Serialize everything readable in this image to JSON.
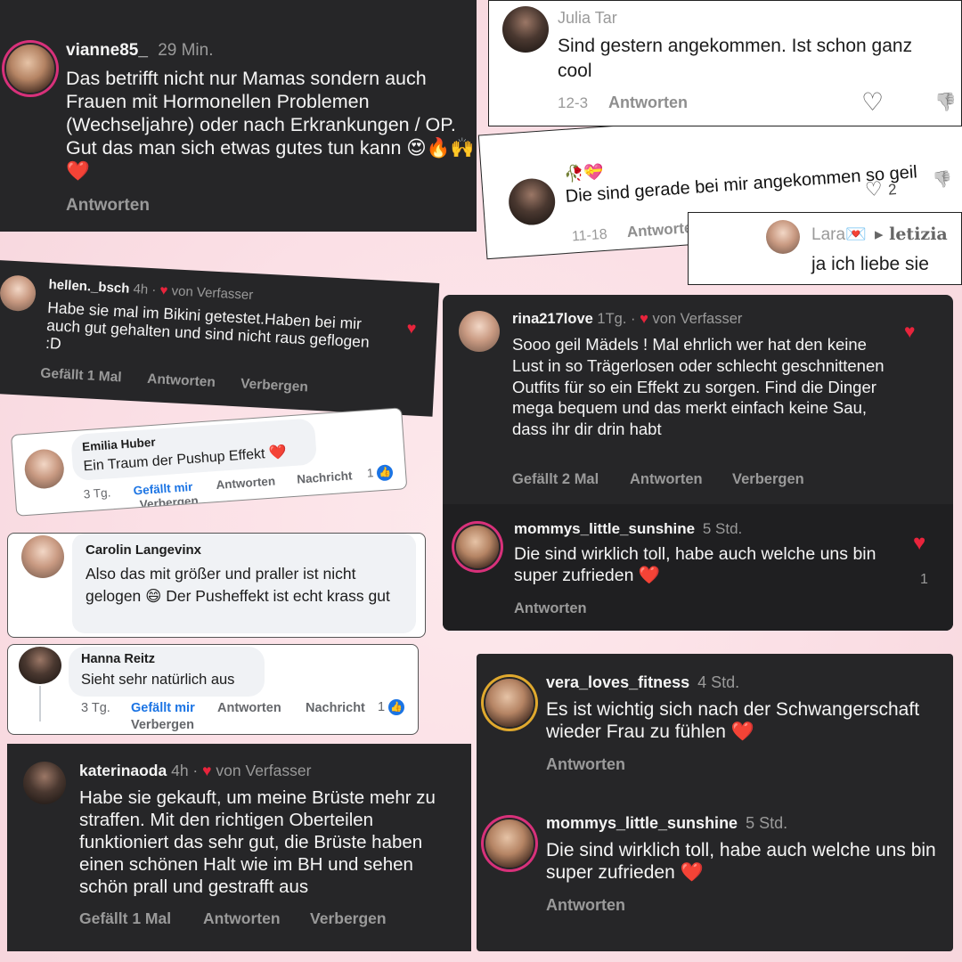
{
  "c1": {
    "username": "vianne85_",
    "time": "29 Min.",
    "text": "Das betrifft nicht nur Mamas sondern auch Frauen mit Hormonellen Problemen (Wechseljahre) oder nach Erkrankungen / OP. Gut das man sich etwas gutes tun kann 😍🔥🙌❤️",
    "reply": "Antworten"
  },
  "c2": {
    "username": "Julia Tar",
    "text": "Sind gestern angekommen. Ist schon ganz cool",
    "date": "12-3",
    "reply": "Antworten"
  },
  "c3": {
    "emoji": "🥀💝",
    "text": "Die sind gerade bei mir angekommen so geil",
    "date": "11-18",
    "reply": "Antworten",
    "likes": "2"
  },
  "c4": {
    "username": "Lara💌",
    "mention": "▸ letizia",
    "text": "ja ich liebe sie"
  },
  "c5": {
    "username": "hellen._bsch",
    "time": "4h ·",
    "author_badge": "von Verfasser",
    "text": "Habe sie mal im Bikini getestet.Haben bei mir auch gut gehalten und sind nicht raus geflogen :D",
    "likes": "Gefällt 1 Mal",
    "reply": "Antworten",
    "hide": "Verbergen"
  },
  "c6": {
    "username": "rina217love",
    "time": "1Tg. ·",
    "author_badge": "von Verfasser",
    "text": "Sooo geil Mädels ! Mal ehrlich wer hat den keine Lust in so Trägerlosen oder schlecht geschnittenen Outfits für so ein Effekt zu sorgen. Find die Dinger mega bequem und das merkt einfach keine Sau, dass ihr dir drin habt",
    "likes": "Gefällt 2 Mal",
    "reply": "Antworten",
    "hide": "Verbergen"
  },
  "c7": {
    "username": "Emilia Huber",
    "text": "Ein Traum der Pushup Effekt ❤️",
    "age": "3 Tg.",
    "like": "Gefällt mir",
    "reply": "Antworten",
    "message": "Nachricht",
    "count": "1",
    "hide": "Verbergen"
  },
  "c8": {
    "username": "mommys_little_sunshine",
    "time": "5 Std.",
    "text": "Die sind wirklich toll, habe auch welche uns bin super zufrieden ❤️",
    "reply": "Antworten",
    "likes": "1"
  },
  "c9": {
    "username": "Carolin Langevinx",
    "text": "Also das mit größer und praller ist nicht gelogen 😄 Der Pusheffekt ist echt krass gut"
  },
  "c10": {
    "username": "Hanna Reitz",
    "text": "Sieht sehr natürlich aus",
    "age": "3 Tg.",
    "like": "Gefällt mir",
    "reply": "Antworten",
    "message": "Nachricht",
    "count": "1",
    "hide": "Verbergen"
  },
  "c11": {
    "username": "vera_loves_fitness",
    "time": "4 Std.",
    "text": "Es ist wichtig sich nach der Schwangerschaft wieder Frau zu fühlen ❤️",
    "reply": "Antworten"
  },
  "c12": {
    "username": "mommys_little_sunshine",
    "time": "5 Std.",
    "text": "Die sind wirklich toll, habe auch welche uns bin super zufrieden ❤️",
    "reply": "Antworten"
  },
  "c13": {
    "username": "katerinaoda",
    "time": "4h ·",
    "author_badge": "von Verfasser",
    "text": "Habe sie gekauft, um meine Brüste mehr zu straffen. Mit den richtigen Oberteilen funktioniert das sehr gut, die Brüste haben einen schönen Halt wie im BH und sehen schön prall und gestrafft aus",
    "likes": "Gefällt 1 Mal",
    "reply": "Antworten",
    "hide": "Verbergen"
  },
  "icons": {
    "heart": "♥",
    "heart_outline": "♡",
    "thumbs_down": "👎",
    "fb_like": "👍"
  },
  "colors": {
    "dark_card": "#262628",
    "accent_red": "#e8243c",
    "fb_blue": "#1b74e4"
  }
}
